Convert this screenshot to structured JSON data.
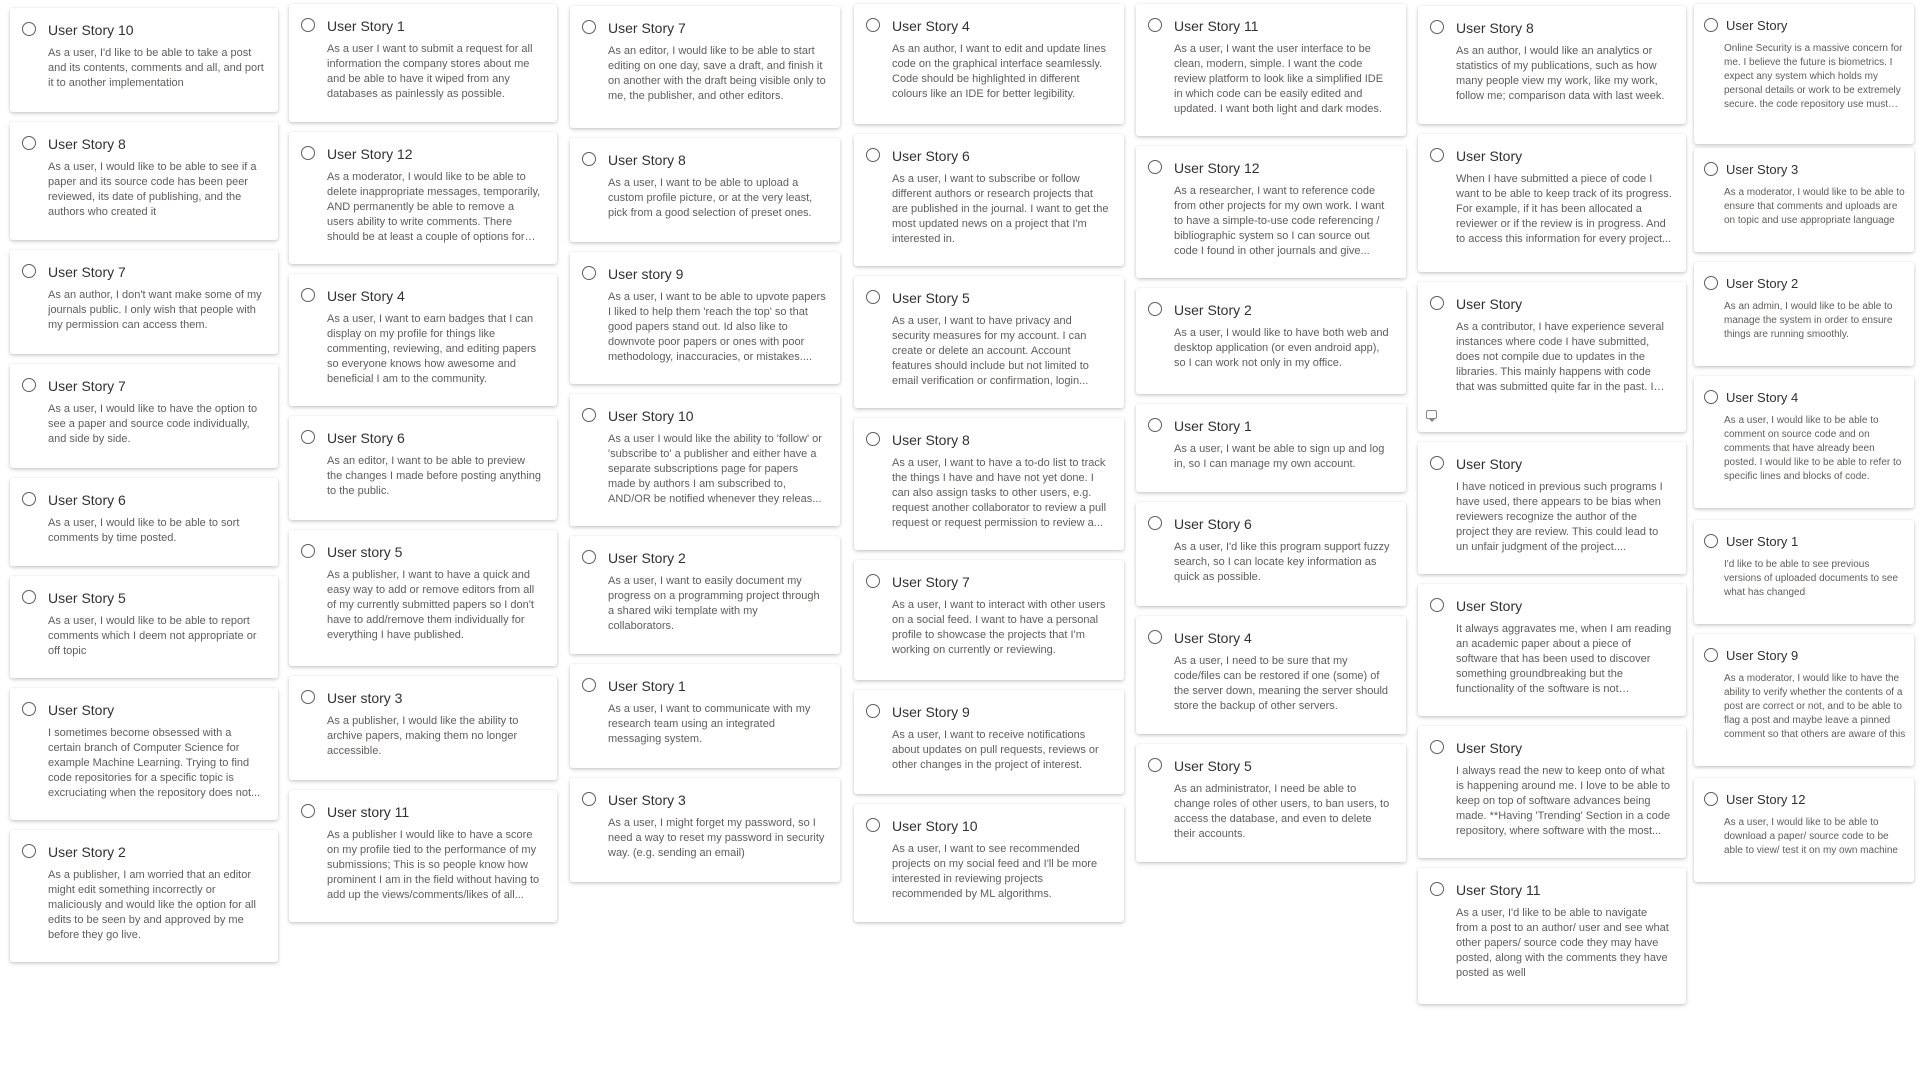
{
  "columns": [
    {
      "cards": [
        {
          "title": "User Story 10",
          "text": "As a user, I'd like to be able to take a post and its contents, comments and all, and port it to another implementation"
        },
        {
          "title": "User Story 8",
          "text": "As a user, I would like to be able to see if a paper and its source code has been peer reviewed, its date of publishing, and the authors who created it"
        },
        {
          "title": "User Story 7",
          "text": "As an author, I don't want make some of my journals public. I only wish that people with my permission can access them."
        },
        {
          "title": "User Story 7",
          "text": "As a user, I would like to have the option to see a paper and source code individually, and side by side."
        },
        {
          "title": "User Story 6",
          "text": "As a user, I would like to be able to sort comments by time posted."
        },
        {
          "title": "User Story 5",
          "text": "As a user, I would like to be able to report comments which I deem not appropriate or off topic"
        },
        {
          "title": "User Story",
          "text": "I sometimes become obsessed with a certain branch of Computer Science for example Machine Learning. Trying to find code repositories for a specific topic is excruciating when the repository does not..."
        },
        {
          "title": "User Story 2",
          "text": "As a publisher, I am worried that an editor might edit something incorrectly or maliciously and would like the option for all edits to be seen by and approved by me before they go live."
        }
      ]
    },
    {
      "cards": [
        {
          "title": "User Story 1",
          "text": "As a user I want to submit a request for all information the company stores about me and be able to have it wiped from any databases as painlessly as possible."
        },
        {
          "title": "User Story 12",
          "text": "As a moderator, I would like to be able to delete inappropriate messages, temporarily, AND permanently be able to remove a users ability to write comments. There should be at least a couple of options for temporarily..."
        },
        {
          "title": "User Story 4",
          "text": "As a user, I want to earn badges that I can display on my profile for things like commenting, reviewing, and editing papers so everyone knows how awesome and beneficial I am to the community."
        },
        {
          "title": "User Story 6",
          "text": "As an editor, I want to be able to preview the changes I made before posting anything to the public."
        },
        {
          "title": "User story 5",
          "text": "As a publisher, I want to have a quick and easy way to add or remove editors from all of my currently submitted papers so I don't have to add/remove them individually for everything I have published."
        },
        {
          "title": "User story 3",
          "text": "As a publisher, I would like the ability to archive papers, making them no longer accessible."
        },
        {
          "title": "User story 11",
          "text": "As a publisher I would like to have a score on my profile tied to the performance of my submissions; This is so people know how prominent I am in the field without having to add up the views/comments/likes of all..."
        }
      ]
    },
    {
      "cards": [
        {
          "title": "User Story 7",
          "text": "As an editor, I would like to be able to start editing on one day, save a draft, and finish it on another with the draft being visible only to me, the publisher, and other editors."
        },
        {
          "title": "User Story 8",
          "text": "As a user, I want to be able to upload a custom profile picture, or at the very least, pick from a good selection of preset ones."
        },
        {
          "title": "User story 9",
          "text": "As a user, I want to be able to upvote papers I liked to help them 'reach the top' so that good papers stand out. Id also like to downvote poor papers or ones with poor methodology, inaccuracies, or mistakes...."
        },
        {
          "title": "User Story 10",
          "text": "As a user I would like the ability to 'follow' or 'subscribe to' a publisher and either have a separate subscriptions page for papers made by authors I am subscribed to, AND/OR be notified whenever they releas..."
        },
        {
          "title": "User Story 2",
          "text": "As a user, I want to easily document my progress on a programming project through a shared wiki template with my collaborators."
        },
        {
          "title": "User Story 1",
          "text": "As a user, I want to communicate with my research team using an integrated messaging system."
        },
        {
          "title": "User Story 3",
          "text": "As a user, I might forget my password, so I need a way to reset my password in security way. (e.g. sending an email)"
        }
      ]
    },
    {
      "cards": [
        {
          "title": "User Story 4",
          "text": "As an author, I want to edit and update lines code on the graphical interface seamlessly. Code should be highlighted in different colours like an IDE for better legibility."
        },
        {
          "title": "User Story 6",
          "text": "As a user, I want to subscribe or follow different authors or research projects that are published in the journal. I want to get the most updated news on a project that I'm interested in."
        },
        {
          "title": "User Story 5",
          "text": "As a user, I want to have privacy and security measures for my account. I can create or delete an account. Account features should include but not limited to email verification or confirmation, login..."
        },
        {
          "title": "User Story 8",
          "text": "As a user, I want to have a to-do list to track the things I have and have not yet done. I can also assign tasks to other users, e.g. request another collaborator to review a pull request or request permission to review a..."
        },
        {
          "title": "User Story 7",
          "text": "As a user, I want to interact with other users on a social feed. I want to have a personal profile to showcase the projects that I'm working on currently or reviewing."
        },
        {
          "title": "User Story 9",
          "text": "As a user, I want to receive notifications about updates on pull requests, reviews or other changes in the project of interest."
        },
        {
          "title": "User Story 10",
          "text": "As a user, I want to see recommended projects on my social feed and I'll be more interested in reviewing projects recommended by ML algorithms."
        }
      ]
    },
    {
      "cards": [
        {
          "title": "User Story 11",
          "text": "As a user, I want the user interface to be clean, modern, simple. I want the code review platform to look like a simplified IDE in which code can be easily edited and updated. I want both light and dark modes."
        },
        {
          "title": "User Story 12",
          "text": "As a researcher, I want to reference code from other projects for my own work. I want to have a simple-to-use code referencing / bibliographic system so I can source out code I found in other journals and give..."
        },
        {
          "title": "User Story 2",
          "text": "As a user, I would like to have both web and desktop application (or even android app), so I can work not only in my office."
        },
        {
          "title": "User Story 1",
          "text": "As a user, I want be able to sign up and log in, so I can manage my own account."
        },
        {
          "title": "User Story 6",
          "text": "As a user, I'd like this program support fuzzy search, so I can locate key information as quick as possible."
        },
        {
          "title": "User Story 4",
          "text": "As a user, I need to be sure that my code/files can be restored if one (some) of the server down, meaning the server should store the backup of other servers."
        },
        {
          "title": "User Story 5",
          "text": "As an administrator, I need be able to change roles of other users, to ban users, to access the database, and even to delete their accounts."
        }
      ]
    },
    {
      "cards": [
        {
          "title": "User Story 8",
          "text": "As an author, I would like an analytics or statistics of my publications, such as how many people view my work, like my work, follow me; comparison data with last week."
        },
        {
          "title": "User Story",
          "text": "When I have submitted a piece of code I want to be able to keep track of its progress. For example, if it has been allocated a reviewer or if the review is in progress. And to access this information for every project..."
        },
        {
          "title": "User Story",
          "text": "As a contributor, I have experience several instances where code I have submitted, does not compile due to updates in the libraries. This mainly happens with code that was submitted quite far in the past. I havin..."
        },
        {
          "title": "User Story",
          "text": "I have noticed in previous such programs I have used, there appears to be bias when reviewers recognize the author of the project they are review. This could lead to un unfair judgment of the project...."
        },
        {
          "title": "User Story",
          "text": "It always aggravates me, when I am reading an academic paper about a piece of software that has been used to discover something groundbreaking but the functionality of the software is not detailed...."
        },
        {
          "title": "User Story",
          "text": "I always read the new to keep onto of what is happening around me. I love to be able to keep on top of software advances being made. **Having 'Trending' Section in a code repository, where software with the most..."
        },
        {
          "title": "User Story 11",
          "text": "As a user, I'd like to be able to navigate from a post to an author/ user and see what other papers/ source code they may have posted, along with the comments they have posted as well"
        }
      ]
    },
    {
      "cards": [
        {
          "title": "User Story",
          "text": "Online Security is a massive concern for me. I believe the future is biometrics. I expect any system which holds my personal details or work to be extremely secure. the code repository use must have **biometric..."
        },
        {
          "title": "User Story 3",
          "text": "As a moderator, I would like to be able to ensure that comments and uploads are on topic and use appropriate language"
        },
        {
          "title": "User Story 2",
          "text": "As an admin, I would like to be able to manage the system in order to ensure things are running smoothly."
        },
        {
          "title": "User Story 4",
          "text": "As a user, I would like to be able to comment on source code and on comments that have already been posted. I would like to be able to refer to specific lines and blocks of code."
        },
        {
          "title": "User Story 1",
          "text": "I'd like to be able to see previous versions of uploaded documents to see what has changed"
        },
        {
          "title": "User Story 9",
          "text": "As a moderator, I would like to have the ability to verify whether the contents of a post are correct or not, and to be able to flag a post and maybe leave a pinned comment so that others are aware of this"
        },
        {
          "title": "User Story 12",
          "text": "As a user, I would like to be able to download a paper/ source code to be able to view/ test it on my own machine"
        }
      ]
    }
  ]
}
